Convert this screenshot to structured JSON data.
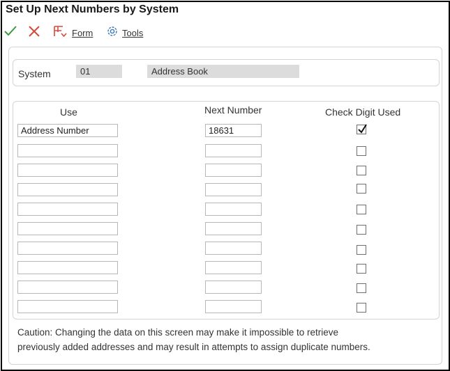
{
  "window": {
    "title": "Set Up Next Numbers by System"
  },
  "toolbar": {
    "ok_icon": "checkmark-icon",
    "cancel_icon": "close-icon",
    "form_label": "Form",
    "form_icon": "form-icon",
    "tools_label": "Tools",
    "tools_icon": "gear-icon",
    "ok_color": "#3c9a3c",
    "cancel_color": "#d64a3a",
    "form_color": "#d64a3a",
    "tools_color": "#3a78b8"
  },
  "system": {
    "label": "System",
    "code": "01",
    "description": "Address Book"
  },
  "grid": {
    "headers": {
      "use": "Use",
      "next_number": "Next Number",
      "check_digit": "Check Digit Used"
    },
    "rows": [
      {
        "use": "Address Number",
        "next_number": "18631",
        "check_digit": true
      },
      {
        "use": "",
        "next_number": "",
        "check_digit": false
      },
      {
        "use": "",
        "next_number": "",
        "check_digit": false
      },
      {
        "use": "",
        "next_number": "",
        "check_digit": false
      },
      {
        "use": "",
        "next_number": "",
        "check_digit": false
      },
      {
        "use": "",
        "next_number": "",
        "check_digit": false
      },
      {
        "use": "",
        "next_number": "",
        "check_digit": false
      },
      {
        "use": "",
        "next_number": "",
        "check_digit": false
      },
      {
        "use": "",
        "next_number": "",
        "check_digit": false
      },
      {
        "use": "",
        "next_number": "",
        "check_digit": false
      }
    ]
  },
  "caution": {
    "line1": "Caution:   Changing the data on this screen may make it impossible to retrieve",
    "line2": "previously added addresses and may result in attempts to assign duplicate numbers."
  }
}
